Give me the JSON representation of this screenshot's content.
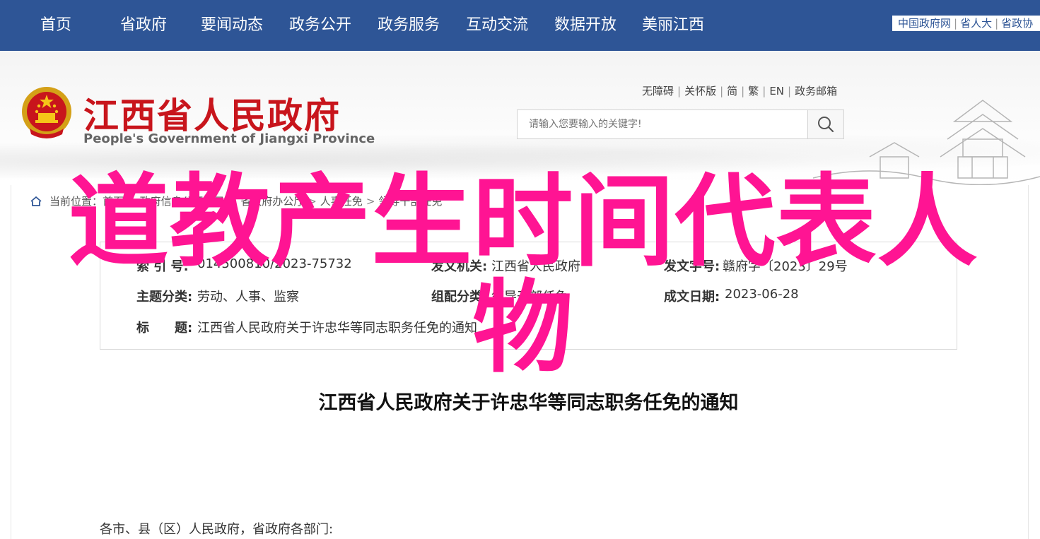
{
  "nav": {
    "items": [
      "首页",
      "省政府",
      "要闻动态",
      "政务公开",
      "政务服务",
      "互动交流",
      "数据开放",
      "美丽江西"
    ],
    "top_links": [
      "中国政府网",
      "省人大",
      "省政协"
    ]
  },
  "header": {
    "title_cn": "江西省人民政府",
    "title_en": "People's Government of Jiangxi Province",
    "util_links": [
      "无障碍",
      "关怀版",
      "简",
      "繁",
      "EN",
      "政务邮箱"
    ],
    "search": {
      "placeholder": "请输入您要输入的关键字!"
    }
  },
  "breadcrumb": {
    "items": [
      "当前位置：",
      "首页",
      "政府信息公开目录",
      "省政府办公厅",
      "人事任免",
      "领导干部任免"
    ]
  },
  "meta": {
    "index_label": "索  引  号:",
    "index_value": "014500810/2023-75732",
    "issuer_label": "发文机关:",
    "issuer_value": "江西省人民政府",
    "doc_no_label": "发文字号:",
    "doc_no_value": "赣府字〔2023〕29号",
    "topic_label": "主题分类:",
    "topic_value": "劳动、人事、监察",
    "category_label": "组配分类:",
    "category_value": "领导干部任免",
    "date_label": "成文日期:",
    "date_value": "2023-06-28",
    "title_label": "标　　题:",
    "title_value": "江西省人民政府关于许忠华等同志职务任免的通知"
  },
  "document": {
    "title": "江西省人民政府关于许忠华等同志职务任免的通知",
    "salutation": "各市、县（区）人民政府，省政府各部门:"
  },
  "overlay": {
    "text": "道教产生时间代表人物"
  },
  "colors": {
    "nav_bg": "#2e5596",
    "title_red": "#c8151c",
    "overlay_pink": "#ff1493"
  }
}
